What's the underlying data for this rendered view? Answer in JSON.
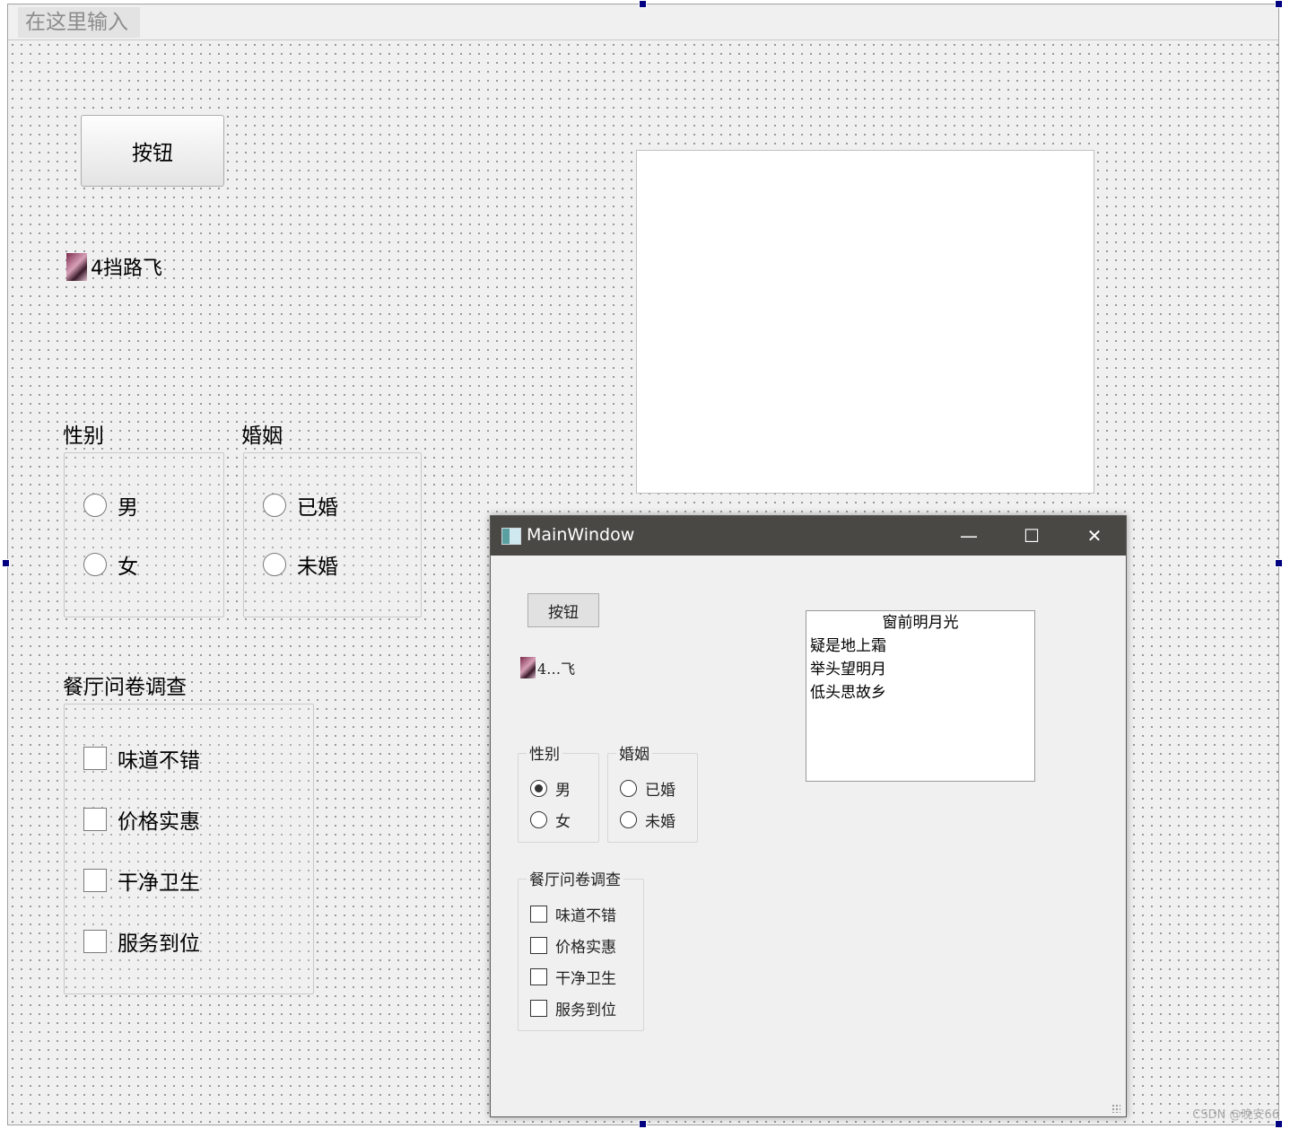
{
  "designer": {
    "menu_placeholder": "在这里输入",
    "button_label": "按钮",
    "image_label_text": "4挡路飞",
    "gender_group": {
      "title": "性别",
      "options": [
        "男",
        "女"
      ]
    },
    "marriage_group": {
      "title": "婚姻",
      "options": [
        "已婚",
        "未婚"
      ]
    },
    "survey_group": {
      "title": "餐厅问卷调查",
      "options": [
        "味道不错",
        "价格实惠",
        "干净卫生",
        "服务到位"
      ]
    }
  },
  "preview_window": {
    "title": "MainWindow",
    "controls": {
      "minimize": "—",
      "maximize": "☐",
      "close": "✕"
    },
    "button_label": "按钮",
    "image_label_text": "4…飞",
    "gender_group": {
      "title": "性别",
      "options": [
        "男",
        "女"
      ],
      "selected": "男"
    },
    "marriage_group": {
      "title": "婚姻",
      "options": [
        "已婚",
        "未婚"
      ]
    },
    "survey_group": {
      "title": "餐厅问卷调查",
      "options": [
        "味道不错",
        "价格实惠",
        "干净卫生",
        "服务到位"
      ]
    },
    "poem_list": [
      "窗前明月光",
      "疑是地上霜",
      "举头望明月",
      "低头思故乡"
    ]
  },
  "watermark": "CSDN @晚安66",
  "colors": {
    "canvas_bg": "#f0f0f0",
    "titlebar_bg": "#4a4845",
    "handle": "#000080"
  }
}
